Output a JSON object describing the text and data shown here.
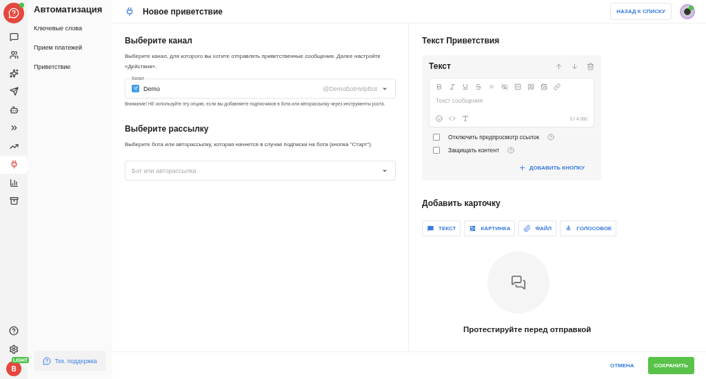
{
  "rail": {
    "items": [
      {
        "kind": "chat",
        "selected": false
      },
      {
        "kind": "users",
        "selected": false
      },
      {
        "kind": "sparkles",
        "selected": false
      },
      {
        "kind": "send",
        "selected": false
      },
      {
        "kind": "bot",
        "selected": false
      },
      {
        "kind": "chevrons",
        "selected": false
      },
      {
        "kind": "trend",
        "selected": false
      },
      {
        "kind": "plug",
        "selected": true
      },
      {
        "kind": "chart",
        "selected": false
      },
      {
        "kind": "archive",
        "selected": false
      }
    ],
    "bottom": [
      {
        "kind": "help"
      },
      {
        "kind": "settings"
      }
    ],
    "user": {
      "initial": "B",
      "badge": "LIGHT"
    }
  },
  "sidebar": {
    "title": "Автоматизация",
    "items": [
      "Ключевые слова",
      "Прием платежей",
      "Приветствие"
    ],
    "support": "Тех. поддержка"
  },
  "header": {
    "title": "Новое приветствие",
    "back_button": "НАЗАД К СПИСКУ"
  },
  "channel": {
    "title": "Выберите канал",
    "description": "Выберите канал, для которого вы хотите отправлять приветственные сообщения. Далее настройте «Действия».",
    "field_label": "Канал",
    "value": "Demo",
    "handle": "@DemoBotHelpBot",
    "warning": "Внимание! НЕ используйте эту опцию, если вы добавляете подписчиков в бота или авторассылку через инструменты роста."
  },
  "mailing": {
    "title": "Выберите рассылку",
    "description": "Выберите бота или авторассылку, которая начнется в случае подписки на бота (кнопка \"Старт\").",
    "placeholder": "Бот или авторассылка"
  },
  "greeting": {
    "title": "Текст Приветствия",
    "card_title": "Текст",
    "placeholder": "Текст сообщения",
    "counter": "0 / 4 000",
    "options": [
      {
        "label": "Отключить предпросмотр ссылок",
        "checked": false
      },
      {
        "label": "Защищать контент",
        "checked": false
      }
    ],
    "add_button": "ДОБАВИТЬ КНОПКУ"
  },
  "add_card": {
    "title": "Добавить карточку",
    "buttons": [
      {
        "kind": "text",
        "label": "ТЕКСТ"
      },
      {
        "kind": "image",
        "label": "КАРТИНКА"
      },
      {
        "kind": "file",
        "label": "ФАЙЛ"
      },
      {
        "kind": "voice",
        "label": "ГОЛОСОВОЕ"
      }
    ]
  },
  "test": {
    "title": "Протестируйте перед отправкой"
  },
  "footer": {
    "cancel": "ОТМЕНА",
    "save": "СОХРАНИТЬ"
  }
}
